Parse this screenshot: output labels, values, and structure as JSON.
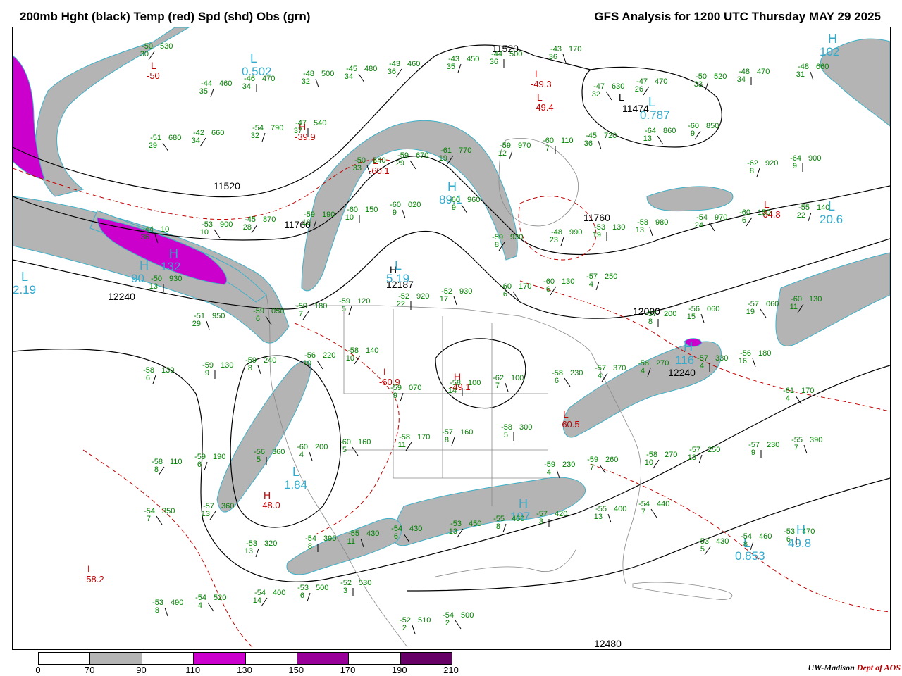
{
  "header": {
    "left_title": "200mb Hght (black) Temp (red) Spd (shd) Obs (grn)",
    "right_title": "GFS Analysis for 1200 UTC Thursday  MAY 29 2025"
  },
  "colors": {
    "height_contours": "#000000",
    "temperature_contours": "#c00000",
    "speed_70_90": "#b4b4b4",
    "speed_110_130": "#cc00cc",
    "speed_150_170": "#990099",
    "speed_190_210": "#660066",
    "observations": "#008000",
    "pressure_centers": "#33aacc"
  },
  "height_labels": [
    "11520",
    "11760",
    "12000",
    "12240",
    "12480",
    "11474",
    "12187",
    "12000",
    "12240",
    "11760",
    "11520"
  ],
  "height_centers": [
    {
      "type": "L",
      "value": "11474"
    },
    {
      "type": "H",
      "value": "12187"
    }
  ],
  "temp_centers": [
    {
      "type": "L",
      "value": "-49.3"
    },
    {
      "type": "L",
      "value": "-49.4"
    },
    {
      "type": "H",
      "value": "-39.9"
    },
    {
      "type": "L",
      "value": "-60.1"
    },
    {
      "type": "L",
      "value": "-64.8"
    },
    {
      "type": "H",
      "value": "-49.1"
    },
    {
      "type": "L",
      "value": "-60.9"
    },
    {
      "type": "L",
      "value": "-60.5"
    },
    {
      "type": "H",
      "value": "-48.0"
    },
    {
      "type": "L",
      "value": "-58.2"
    },
    {
      "type": "L",
      "value": "-50"
    }
  ],
  "speed_centers": [
    {
      "type": "L",
      "value": "0.502"
    },
    {
      "type": "L",
      "value": "0.787"
    },
    {
      "type": "H",
      "value": "89.1"
    },
    {
      "type": "H",
      "value": "102"
    },
    {
      "type": "L",
      "value": "20.6"
    },
    {
      "type": "H",
      "value": "132"
    },
    {
      "type": "L",
      "value": "2.19"
    },
    {
      "type": "H",
      "value": "116"
    },
    {
      "type": "L",
      "value": "1.84"
    },
    {
      "type": "H",
      "value": "107"
    },
    {
      "type": "H",
      "value": "49.8"
    },
    {
      "type": "L",
      "value": "0.853"
    },
    {
      "type": "L",
      "value": "5.19"
    },
    {
      "type": "H",
      "value": "90"
    }
  ],
  "observations": [
    {
      "t": "-50",
      "h": "530",
      "d": "30"
    },
    {
      "t": "-44",
      "h": "460",
      "d": "35"
    },
    {
      "t": "-46",
      "h": "470",
      "d": "34"
    },
    {
      "t": "-48",
      "h": "500",
      "d": "32"
    },
    {
      "t": "-45",
      "h": "480",
      "d": "34"
    },
    {
      "t": "-43",
      "h": "460",
      "d": "36"
    },
    {
      "t": "-43",
      "h": "450",
      "d": "35"
    },
    {
      "t": "-44",
      "h": "500",
      "d": "36"
    },
    {
      "t": "-43",
      "h": "170",
      "d": "36"
    },
    {
      "t": "-47",
      "h": "630",
      "d": "32"
    },
    {
      "t": "-47",
      "h": "470",
      "d": "26"
    },
    {
      "t": "-50",
      "h": "520",
      "d": "33"
    },
    {
      "t": "-48",
      "h": "470",
      "d": "34"
    },
    {
      "t": "-48",
      "h": "660",
      "d": "31"
    },
    {
      "t": "-51",
      "h": "680",
      "d": "29"
    },
    {
      "t": "-42",
      "h": "660",
      "d": "34"
    },
    {
      "t": "-54",
      "h": "790",
      "d": "32"
    },
    {
      "t": "-47",
      "h": "540",
      "d": "37"
    },
    {
      "t": "-50",
      "h": "840",
      "d": "33"
    },
    {
      "t": "-59",
      "h": "670",
      "d": "29"
    },
    {
      "t": "-61",
      "h": "770",
      "d": "19"
    },
    {
      "t": "-59",
      "h": "970",
      "d": "12"
    },
    {
      "t": "-60",
      "h": "110",
      "d": "7"
    },
    {
      "t": "-45",
      "h": "720",
      "d": "36"
    },
    {
      "t": "-64",
      "h": "860",
      "d": "13"
    },
    {
      "t": "-60",
      "h": "850",
      "d": "9"
    },
    {
      "t": "-62",
      "h": "920",
      "d": "8"
    },
    {
      "t": "-64",
      "h": "900",
      "d": "9"
    },
    {
      "t": "-44",
      "h": "10",
      "d": "36"
    },
    {
      "t": "-53",
      "h": "900",
      "d": "10"
    },
    {
      "t": "-45",
      "h": "870",
      "d": "28"
    },
    {
      "t": "-59",
      "h": "190",
      "d": "10"
    },
    {
      "t": "-60",
      "h": "150",
      "d": "10"
    },
    {
      "t": "-60",
      "h": "020",
      "d": "9"
    },
    {
      "t": "-60",
      "h": "960",
      "d": "9"
    },
    {
      "t": "-59",
      "h": "930",
      "d": "8"
    },
    {
      "t": "-48",
      "h": "990",
      "d": "23"
    },
    {
      "t": "-53",
      "h": "130",
      "d": "19"
    },
    {
      "t": "-58",
      "h": "980",
      "d": "13"
    },
    {
      "t": "-54",
      "h": "970",
      "d": "24"
    },
    {
      "t": "-60",
      "h": "150",
      "d": "6"
    },
    {
      "t": "-55",
      "h": "140",
      "d": "22"
    },
    {
      "t": "-50",
      "h": "930",
      "d": "13"
    },
    {
      "t": "-51",
      "h": "950",
      "d": "29"
    },
    {
      "t": "-59",
      "h": "050",
      "d": "6"
    },
    {
      "t": "-59",
      "h": "180",
      "d": "7"
    },
    {
      "t": "-59",
      "h": "120",
      "d": "5"
    },
    {
      "t": "-52",
      "h": "920",
      "d": "22"
    },
    {
      "t": "-52",
      "h": "930",
      "d": "17"
    },
    {
      "t": "-60",
      "h": "170",
      "d": "6"
    },
    {
      "t": "-60",
      "h": "130",
      "d": "6"
    },
    {
      "t": "-57",
      "h": "250",
      "d": "4"
    },
    {
      "t": "-57",
      "h": "200",
      "d": "8"
    },
    {
      "t": "-56",
      "h": "060",
      "d": "15"
    },
    {
      "t": "-57",
      "h": "060",
      "d": "19"
    },
    {
      "t": "-60",
      "h": "130",
      "d": "11"
    },
    {
      "t": "-58",
      "h": "130",
      "d": "6"
    },
    {
      "t": "-59",
      "h": "130",
      "d": "9"
    },
    {
      "t": "-59",
      "h": "240",
      "d": "8"
    },
    {
      "t": "-56",
      "h": "220",
      "d": "10"
    },
    {
      "t": "-58",
      "h": "140",
      "d": "10"
    },
    {
      "t": "-59",
      "h": "070",
      "d": "9"
    },
    {
      "t": "-58",
      "h": "100",
      "d": "14"
    },
    {
      "t": "-62",
      "h": "100",
      "d": "7"
    },
    {
      "t": "-58",
      "h": "230",
      "d": "6"
    },
    {
      "t": "-57",
      "h": "370",
      "d": "4"
    },
    {
      "t": "-58",
      "h": "270",
      "d": "4"
    },
    {
      "t": "-57",
      "h": "330",
      "d": "4"
    },
    {
      "t": "-56",
      "h": "180",
      "d": "16"
    },
    {
      "t": "-61",
      "h": "170",
      "d": "4"
    },
    {
      "t": "-58",
      "h": "110",
      "d": "8"
    },
    {
      "t": "-59",
      "h": "190",
      "d": "6"
    },
    {
      "t": "-56",
      "h": "360",
      "d": "5"
    },
    {
      "t": "-60",
      "h": "200",
      "d": "4"
    },
    {
      "t": "-60",
      "h": "160",
      "d": "5"
    },
    {
      "t": "-58",
      "h": "170",
      "d": "11"
    },
    {
      "t": "-57",
      "h": "160",
      "d": "8"
    },
    {
      "t": "-58",
      "h": "300",
      "d": "5"
    },
    {
      "t": "-59",
      "h": "230",
      "d": "4"
    },
    {
      "t": "-59",
      "h": "260",
      "d": "7"
    },
    {
      "t": "-58",
      "h": "270",
      "d": "10"
    },
    {
      "t": "-57",
      "h": "250",
      "d": "13"
    },
    {
      "t": "-57",
      "h": "230",
      "d": "9"
    },
    {
      "t": "-55",
      "h": "390",
      "d": "7"
    },
    {
      "t": "-54",
      "h": "350",
      "d": "7"
    },
    {
      "t": "-57",
      "h": "360",
      "d": "13"
    },
    {
      "t": "-53",
      "h": "320",
      "d": "13"
    },
    {
      "t": "-54",
      "h": "390",
      "d": "8"
    },
    {
      "t": "-55",
      "h": "430",
      "d": "11"
    },
    {
      "t": "-54",
      "h": "430",
      "d": "6"
    },
    {
      "t": "-53",
      "h": "450",
      "d": "13"
    },
    {
      "t": "-55",
      "h": "460",
      "d": "8"
    },
    {
      "t": "-57",
      "h": "420",
      "d": "3"
    },
    {
      "t": "-55",
      "h": "400",
      "d": "13"
    },
    {
      "t": "-54",
      "h": "440",
      "d": "7"
    },
    {
      "t": "-53",
      "h": "430",
      "d": "5"
    },
    {
      "t": "-54",
      "h": "460",
      "d": "8"
    },
    {
      "t": "-53",
      "h": "470",
      "d": "6"
    },
    {
      "t": "-53",
      "h": "490",
      "d": "8"
    },
    {
      "t": "-54",
      "h": "520",
      "d": "4"
    },
    {
      "t": "-54",
      "h": "400",
      "d": "14"
    },
    {
      "t": "-53",
      "h": "500",
      "d": "6"
    },
    {
      "t": "-52",
      "h": "530",
      "d": "3"
    },
    {
      "t": "-52",
      "h": "510",
      "d": "2"
    },
    {
      "t": "-54",
      "h": "500",
      "d": "2"
    }
  ],
  "legend": {
    "ticks": [
      "0",
      "70",
      "90",
      "110",
      "130",
      "150",
      "170",
      "190",
      "210"
    ],
    "segment_colors": [
      "#ffffff",
      "#b4b4b4",
      "#ffffff",
      "#cc00cc",
      "#ffffff",
      "#990099",
      "#ffffff",
      "#660066"
    ]
  },
  "credit": {
    "org": "UW-Madison",
    "dept": "Dept of AOS"
  }
}
